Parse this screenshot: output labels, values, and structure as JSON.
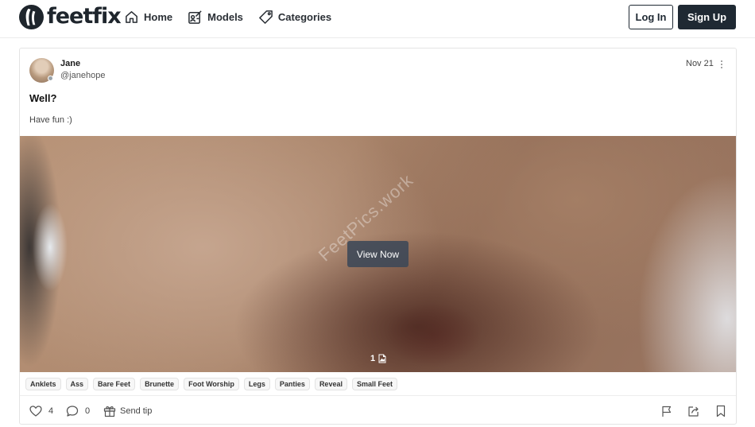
{
  "brand": {
    "name": "feetfix"
  },
  "nav": [
    {
      "label": "Home",
      "icon": "home-icon"
    },
    {
      "label": "Models",
      "icon": "models-icon"
    },
    {
      "label": "Categories",
      "icon": "tag-icon"
    }
  ],
  "auth": {
    "login_label": "Log In",
    "signup_label": "Sign Up"
  },
  "post": {
    "author_name": "Jane",
    "author_handle": "@janehope",
    "date": "Nov 21",
    "title": "Well?",
    "text": "Have fun :)",
    "watermark": "FeetPics.work",
    "view_label": "View Now",
    "media_count": "1",
    "tags": [
      "Anklets",
      "Ass",
      "Bare Feet",
      "Brunette",
      "Foot Worship",
      "Legs",
      "Panties",
      "Reveal",
      "Small Feet"
    ],
    "likes": "4",
    "comments": "0",
    "tip_label": "Send tip"
  },
  "colors": {
    "primary": "#1f2933",
    "border": "#e4e4e4",
    "muted": "#444444"
  }
}
